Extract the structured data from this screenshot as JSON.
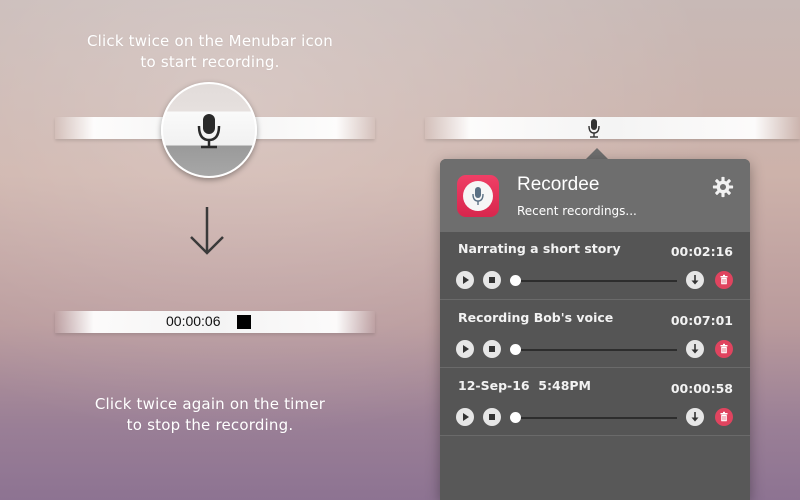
{
  "instructions": {
    "top_line1": "Click twice on the Menubar icon",
    "top_line2": "to start recording.",
    "bottom_line1": "Click twice again on the timer",
    "bottom_line2": "to stop the recording."
  },
  "menubar": {
    "timer_text": "00:00:06"
  },
  "panel": {
    "app_name": "Recordee",
    "subtitle": "Recent recordings...",
    "recordings": [
      {
        "title": "Narrating a short story",
        "duration": "00:02:16"
      },
      {
        "title": "Recording Bob's voice",
        "duration": "00:07:01"
      },
      {
        "title": "12-Sep-16  5:48PM",
        "duration": "00:00:58"
      }
    ]
  },
  "colors": {
    "accent": "#e0445f",
    "panel_bg": "#585858",
    "header_bg": "#6e6e6e"
  },
  "icons": [
    "microphone-icon",
    "arrow-down-icon",
    "stop-icon",
    "gear-icon",
    "play-icon",
    "download-icon",
    "trash-icon"
  ]
}
